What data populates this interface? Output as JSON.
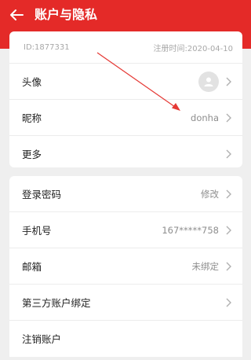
{
  "header": {
    "title": "账户与隐私",
    "back_icon": "back-arrow-icon",
    "bg": "#e42a28"
  },
  "account": {
    "id_text": "ID:1877331",
    "register_text": "注册时间:2020-04-10"
  },
  "profile_rows": [
    {
      "label": "头像",
      "icon": "avatar-icon"
    },
    {
      "label": "昵称",
      "value": "donha"
    },
    {
      "label": "更多"
    }
  ],
  "security_rows": [
    {
      "label": "登录密码",
      "value": "修改"
    },
    {
      "label": "手机号",
      "value": "167*****758"
    },
    {
      "label": "邮箱",
      "value": "未绑定"
    },
    {
      "label": "第三方账户绑定"
    },
    {
      "label": "注销账户"
    }
  ],
  "annotation": {
    "arrow_color": "#e53935"
  }
}
